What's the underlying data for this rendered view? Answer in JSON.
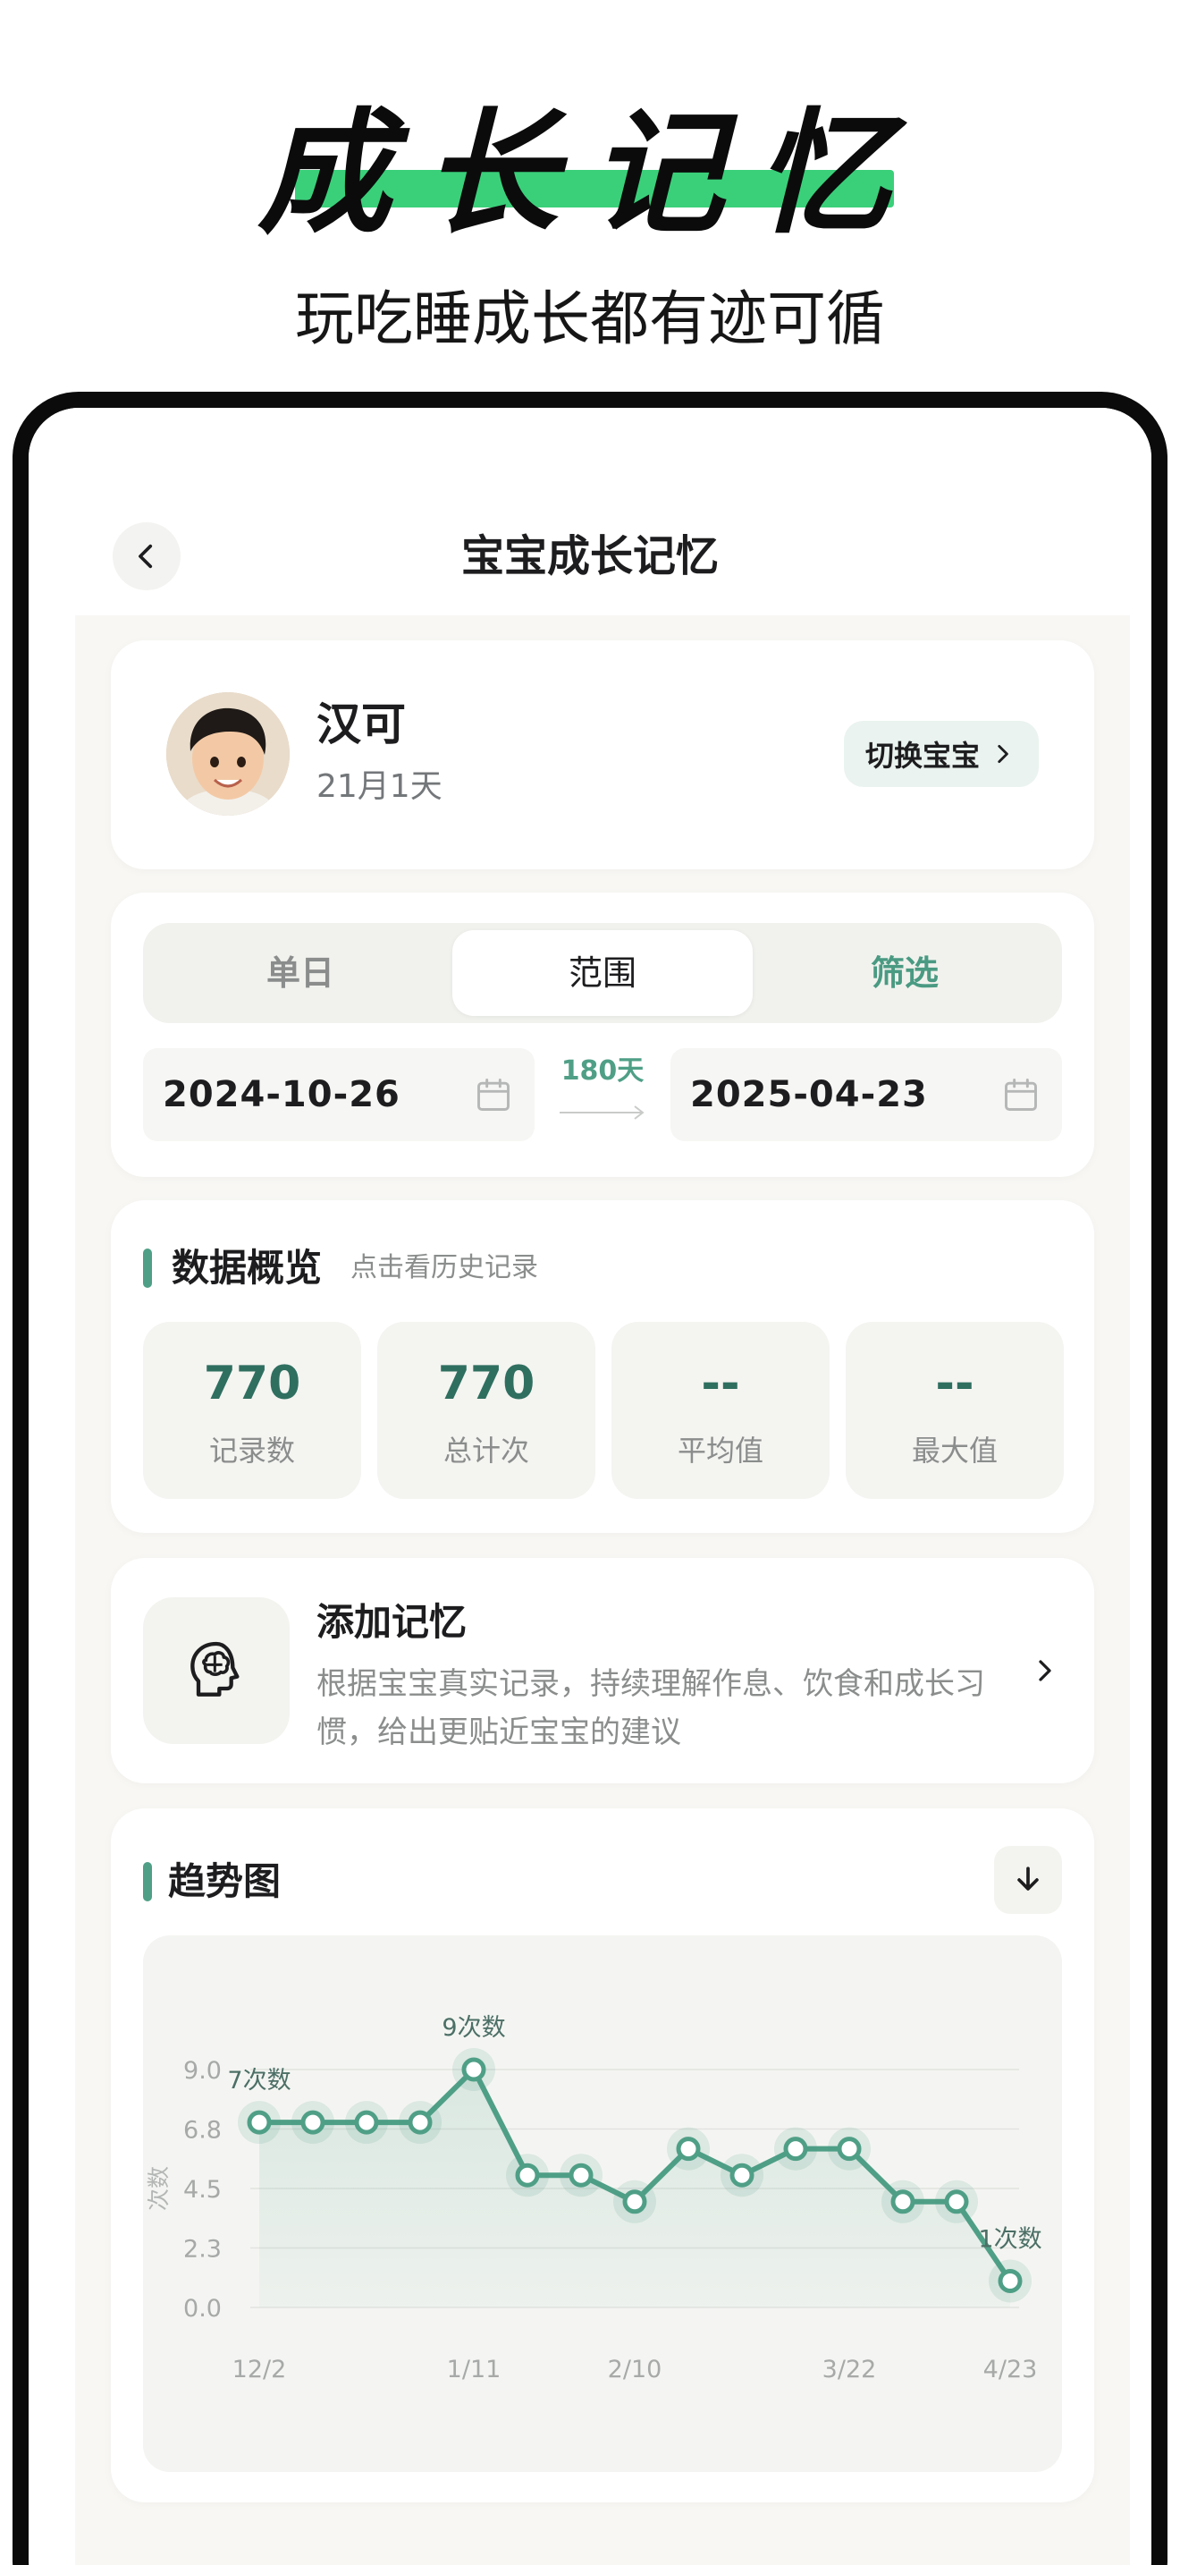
{
  "hero": {
    "title": "成长记忆",
    "subtitle": "玩吃睡成长都有迹可循"
  },
  "nav": {
    "title": "宝宝成长记忆",
    "back_icon": "chevron-left-icon"
  },
  "profile": {
    "name": "汉可",
    "age": "21月1天",
    "switch_label": "切换宝宝"
  },
  "date_filter": {
    "tabs": [
      "单日",
      "范围",
      "筛选"
    ],
    "selected_tab": "范围",
    "start_date": "2024-10-26",
    "end_date": "2025-04-23",
    "days": "180天"
  },
  "overview": {
    "title": "数据概览",
    "hint": "点击看历史记录",
    "stats": [
      {
        "value": "770",
        "label": "记录数"
      },
      {
        "value": "770",
        "label": "总计次"
      },
      {
        "value": "--",
        "label": "平均值"
      },
      {
        "value": "--",
        "label": "最大值"
      }
    ]
  },
  "memory": {
    "title": "添加记忆",
    "description": "根据宝宝真实记录，持续理解作息、饮食和成长习惯，给出更贴近宝宝的建议"
  },
  "trend": {
    "title": "趋势图"
  },
  "colors": {
    "accent": "#4f9f86",
    "hero_highlight": "#3ad07a",
    "stat_value": "#2f6f60"
  },
  "chart_data": {
    "type": "line",
    "ylabel": "次数",
    "yticks": [
      "0.0",
      "2.3",
      "4.5",
      "6.8",
      "9.0"
    ],
    "ylim": [
      0,
      9
    ],
    "xticks": [
      {
        "label": "12/2",
        "index": 0
      },
      {
        "label": "1/11",
        "index": 4
      },
      {
        "label": "2/10",
        "index": 7
      },
      {
        "label": "3/22",
        "index": 11
      },
      {
        "label": "4/23",
        "index": 14
      }
    ],
    "series": [
      {
        "values": [
          7,
          7,
          7,
          7,
          9,
          5,
          5,
          4,
          6,
          5,
          6,
          6,
          4,
          4,
          1
        ]
      }
    ],
    "annotations": [
      {
        "index": 0,
        "text": "7次数"
      },
      {
        "index": 4,
        "text": "9次数"
      },
      {
        "index": 14,
        "text": "1次数"
      }
    ],
    "grid": true
  }
}
